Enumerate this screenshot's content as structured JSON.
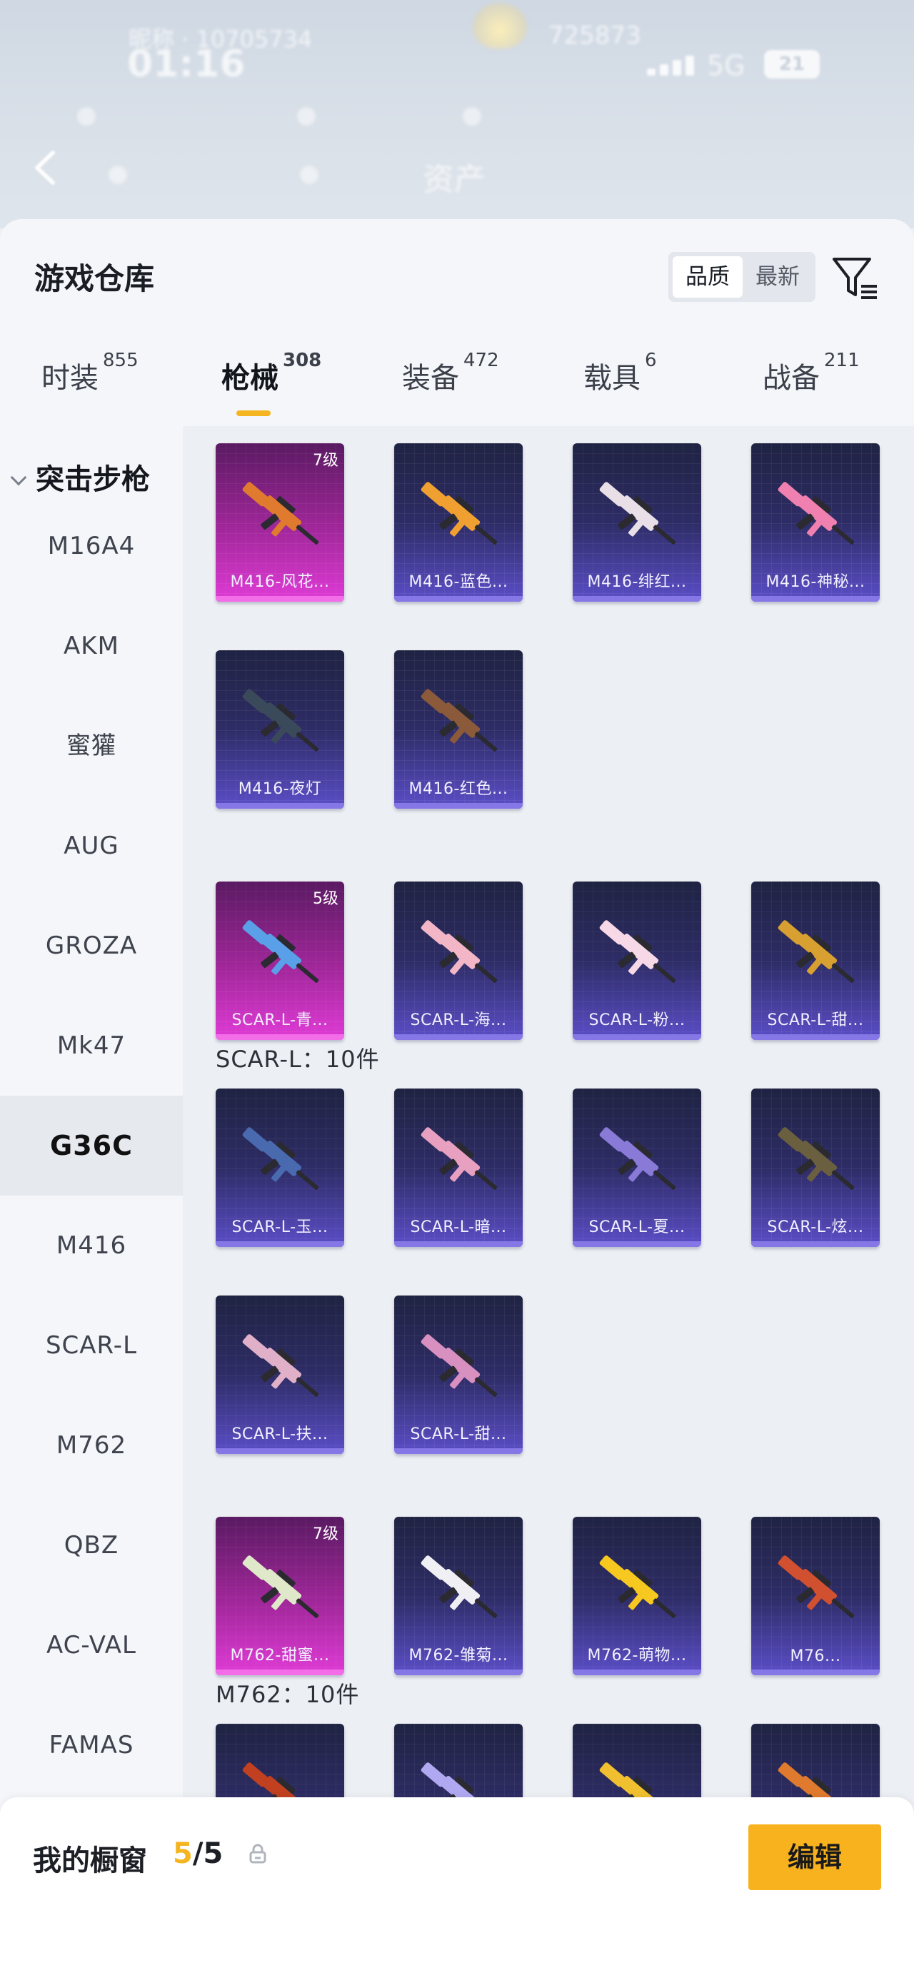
{
  "status": {
    "time": "01:16",
    "ghost_id": "昵称 · 10705734",
    "ghost_num": "725873",
    "network": "5G",
    "battery": "21",
    "page_title": "资产"
  },
  "panel": {
    "title": "游戏仓库",
    "sort": {
      "active": "品质",
      "other": "最新"
    }
  },
  "tabs": [
    {
      "label": "时装",
      "count": "855"
    },
    {
      "label": "枪械",
      "count": "308"
    },
    {
      "label": "装备",
      "count": "472"
    },
    {
      "label": "载具",
      "count": "6"
    },
    {
      "label": "战备",
      "count": "211"
    }
  ],
  "sidebar": {
    "heading": "突击步枪",
    "items": [
      "M16A4",
      "AKM",
      "蜜獾",
      "AUG",
      "GROZA",
      "Mk47",
      "G36C",
      "M416",
      "SCAR-L",
      "M762",
      "QBZ",
      "AC-VAL",
      "FAMAS"
    ],
    "active": "G36C"
  },
  "sections": [
    {
      "label": "",
      "cards": [
        {
          "name": "M416-风花...",
          "level": "7级",
          "tier": "gold"
        },
        {
          "name": "M416-蓝色...",
          "level": "",
          "tier": "purple"
        },
        {
          "name": "M416-绯红...",
          "level": "",
          "tier": "purple"
        },
        {
          "name": "M416-神秘...",
          "level": "",
          "tier": "purple"
        },
        {
          "name": "M416-夜灯",
          "level": "",
          "tier": "purple"
        },
        {
          "name": "M416-红色...",
          "level": "",
          "tier": "purple"
        }
      ]
    },
    {
      "label": "SCAR-L：10件",
      "cards": [
        {
          "name": "SCAR-L-青...",
          "level": "5级",
          "tier": "gold"
        },
        {
          "name": "SCAR-L-海...",
          "level": "",
          "tier": "purple"
        },
        {
          "name": "SCAR-L-粉...",
          "level": "",
          "tier": "purple"
        },
        {
          "name": "SCAR-L-甜...",
          "level": "",
          "tier": "purple"
        },
        {
          "name": "SCAR-L-玉...",
          "level": "",
          "tier": "purple"
        },
        {
          "name": "SCAR-L-暗...",
          "level": "",
          "tier": "purple"
        },
        {
          "name": "SCAR-L-夏...",
          "level": "",
          "tier": "purple"
        },
        {
          "name": "SCAR-L-炫...",
          "level": "",
          "tier": "purple"
        },
        {
          "name": "SCAR-L-扶...",
          "level": "",
          "tier": "purple"
        },
        {
          "name": "SCAR-L-甜...",
          "level": "",
          "tier": "purple"
        }
      ]
    },
    {
      "label": "M762：10件",
      "cards": [
        {
          "name": "M762-甜蜜...",
          "level": "7级",
          "tier": "gold"
        },
        {
          "name": "M762-雏菊...",
          "level": "",
          "tier": "purple"
        },
        {
          "name": "M762-萌物...",
          "level": "",
          "tier": "purple"
        },
        {
          "name": "M76...",
          "level": "",
          "tier": "purple"
        },
        {
          "name": "",
          "level": "",
          "tier": "purple"
        },
        {
          "name": "",
          "level": "",
          "tier": "purple"
        },
        {
          "name": "",
          "level": "",
          "tier": "purple"
        },
        {
          "name": "",
          "level": "",
          "tier": "purple"
        }
      ]
    }
  ],
  "gun_colors": [
    "#e07a2e",
    "#f0a030",
    "#e8e0e6",
    "#f080b0",
    "#3a4a5a",
    "#8a5a3a",
    "#5aa0e8",
    "#f2b6c6",
    "#f6d8e6",
    "#d8a030",
    "#4a6ab0",
    "#e8a0c0",
    "#8a7ad8",
    "#6a6040",
    "#e0b0c8",
    "#d890c0",
    "#dfe8c8",
    "#f0f0f4",
    "#f6c820",
    "#d05030",
    "#c04020",
    "#b0a8f0",
    "#f0c030"
  ],
  "fab": {
    "icon": "share-icon"
  },
  "bottom": {
    "title": "我的橱窗",
    "current": "5",
    "total": "/5",
    "edit_label": "编辑"
  }
}
